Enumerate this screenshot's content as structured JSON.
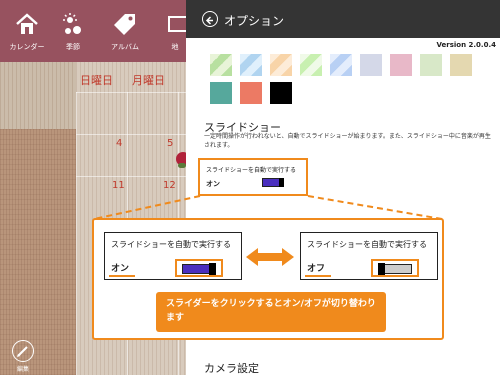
{
  "app": {
    "nav": [
      {
        "label": "カレンダー",
        "icon": "home-icon"
      },
      {
        "label": "季節",
        "icon": "sun-flower-icon"
      },
      {
        "label": "アルバム",
        "icon": "tag-icon"
      },
      {
        "label": "地",
        "icon": "map-icon"
      }
    ],
    "calendar": {
      "weekdays": [
        "日曜日",
        "月曜日"
      ],
      "dates": [
        "4",
        "5",
        "11",
        "12"
      ]
    },
    "edit": {
      "label": "編集",
      "icon": "pencil-icon"
    }
  },
  "options": {
    "title": "オプション",
    "back_icon": "back-arrow-icon",
    "version": "Version 2.0.0.4",
    "theme_swatches": [
      {
        "colors": [
          "#b8e0a0",
          "#e8f4d8"
        ]
      },
      {
        "colors": [
          "#b0d4f0",
          "#e0f0fc"
        ]
      },
      {
        "colors": [
          "#f8d4a8",
          "#fdecd8"
        ]
      },
      {
        "colors": [
          "#c8f0b0",
          "#f0fae8"
        ]
      },
      {
        "colors": [
          "#b8d0f4",
          "#e4edfc"
        ]
      },
      {
        "colors": [
          "#d4d8e8",
          "#d4d8e8"
        ]
      },
      {
        "colors": [
          "#e8b8c8",
          "#e8b8c8"
        ]
      },
      {
        "colors": [
          "#d8e8c8",
          "#d8e8c8"
        ]
      },
      {
        "colors": [
          "#e4d8b0",
          "#e4d8b0"
        ]
      },
      {
        "colors": [
          "#56a89c",
          "#56a89c"
        ]
      },
      {
        "colors": [
          "#ec7a64",
          "#ec7a64"
        ]
      },
      {
        "colors": [
          "#000000",
          "#000000"
        ]
      }
    ],
    "slideshow": {
      "title": "スライドショー",
      "description": "一定時間操作が行われないと、自動でスライドショーが始まります。また、スライドショー中に音楽が再生されます。",
      "toggle_label": "スライドショーを自動で実行する",
      "state": "オン"
    },
    "camera": {
      "title": "カメラ設定"
    }
  },
  "callout": {
    "on_example": {
      "label": "スライドショーを自動で実行する",
      "state": "オン",
      "value": 1
    },
    "off_example": {
      "label": "スライドショーを自動で実行する",
      "state": "オフ",
      "value": 0
    },
    "arrow_icon": "double-arrow-icon",
    "note": "スライダーをクリックするとオン/オフが切り替わります"
  },
  "colors": {
    "accent": "#f08a1c",
    "toggle_on": "#4a2fbf",
    "header": "#343434",
    "appbar": "#97525f",
    "weekday_text": "#c0392b"
  }
}
